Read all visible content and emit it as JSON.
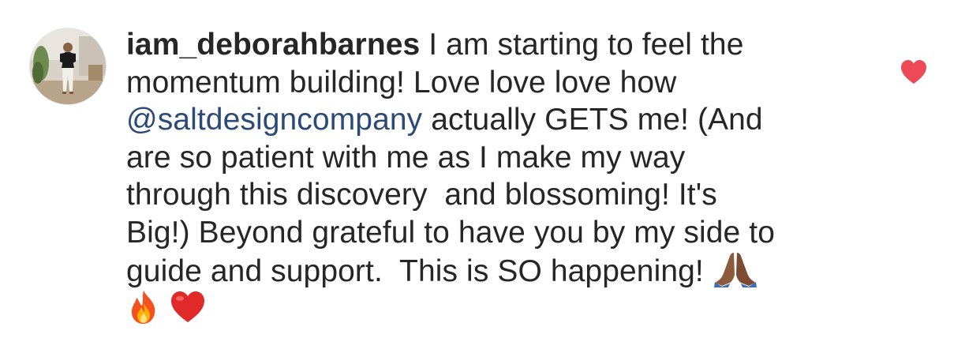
{
  "comment": {
    "username": "iam_deborahbarnes",
    "lines": [
      " I am starting to feel the",
      "momentum building! Love love love how",
      " actually GETS me! (And",
      "are so patient with me as I make my way",
      "through this discovery  and blossoming! It's",
      "Big!) Beyond grateful to have you by my side to",
      "guide and support.  This is SO happening! "
    ],
    "mention": "@saltdesigncompany",
    "emojis": [
      "folded-hands-emoji",
      "fire-emoji",
      "red-heart-emoji"
    ],
    "liked": true
  },
  "colors": {
    "text": "#262626",
    "mention": "#2b4a77",
    "like": "#ed4956"
  },
  "icons": {
    "avatar": "avatar-photo",
    "like": "heart-icon"
  }
}
